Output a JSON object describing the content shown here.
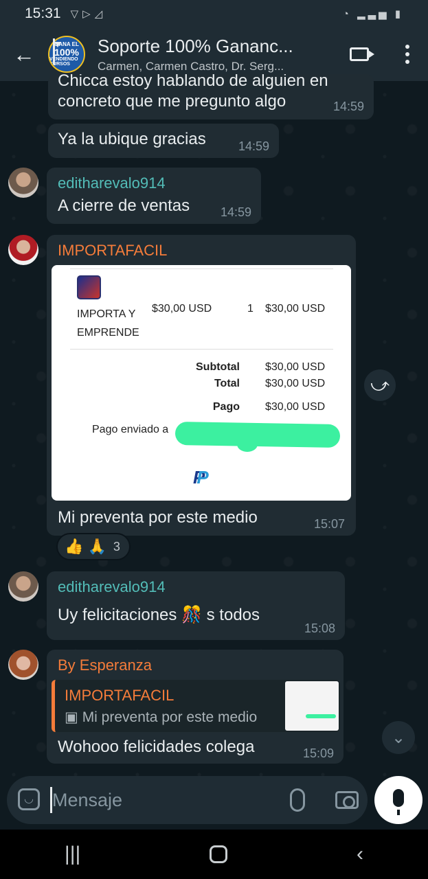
{
  "status": {
    "time": "15:31"
  },
  "header": {
    "group_avatar": {
      "line1": "GANA EL",
      "line2": "100%",
      "line3": "VENDIENDO CURSOS"
    },
    "title": "Soporte 100% Gananc...",
    "subtitle": "Carmen, Carmen Castro, Dr. Serg..."
  },
  "messages": [
    {
      "text": "concreto que me pregunto algo",
      "partial_top": "Chicca estoy hablando de alguien en",
      "time": "14:59"
    },
    {
      "text": "Ya la ubique gracias",
      "time": "14:59"
    },
    {
      "sender": "editharevalo914",
      "sender_color": "#53bdb8",
      "text": "A cierre de ventas",
      "time": "14:59"
    },
    {
      "sender": "IMPORTAFACIL",
      "sender_color": "#f57c3a",
      "receipt": {
        "item_name_line1": "IMPORTA Y",
        "item_name_line2": "EMPRENDE",
        "price": "$30,00 USD",
        "qty": "1",
        "line_total": "$30,00 USD",
        "subtotal_label": "Subtotal",
        "subtotal_value": "$30,00 USD",
        "total_label": "Total",
        "total_value": "$30,00 USD",
        "payment_label": "Pago",
        "payment_value": "$30,00 USD",
        "sent_to": "Pago enviado a"
      },
      "text": "Mi preventa por este medio",
      "time": "15:07",
      "reactions": {
        "emojis": "👍 🙏",
        "count": "3"
      }
    },
    {
      "sender": "editharevalo914",
      "sender_color": "#53bdb8",
      "text_before": "Uy felicitaciones",
      "emoji": "🎊",
      "text_after": "s todos",
      "time": "15:08"
    },
    {
      "sender": "By Esperanza",
      "sender_color": "#f57c3a",
      "quote": {
        "name": "IMPORTAFACIL",
        "text": "Mi preventa por este medio"
      },
      "text": "Wohooo felicidades colega",
      "time": "15:09"
    }
  ],
  "input": {
    "placeholder": "Mensaje"
  }
}
